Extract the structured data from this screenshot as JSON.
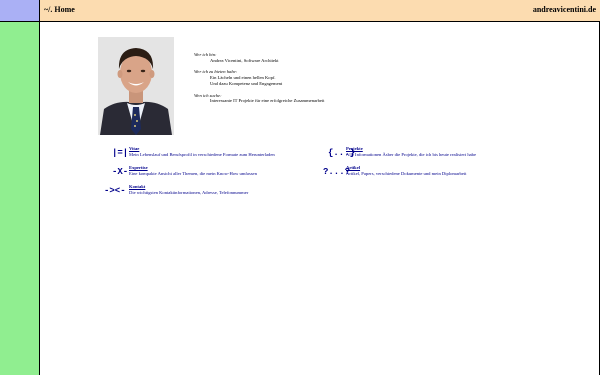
{
  "header": {
    "title": "~/. Home",
    "domain": "andreavicentini.de"
  },
  "intro": [
    {
      "question": "Wer ich bin:",
      "answers": [
        "Andrea Vicentini, Software Architekt"
      ]
    },
    {
      "question": "Wer ich zu bieten habe:",
      "answers": [
        "Ein Lächeln und einen hellen Kopf.",
        "Und dazu Kompetenz und Engagement"
      ]
    },
    {
      "question": "Wen ich suche:",
      "answers": [
        "Interessante IT Projekte für eine erfolgreiche Zusammenarbeit"
      ]
    }
  ],
  "links": {
    "vitae": {
      "symbol": "|=|",
      "name": "Vitae",
      "desc": "Mein Lebenslauf und Berufsprofil in verschiedene Formate zum Herunterladen"
    },
    "projekte": {
      "symbol": "{...}",
      "name": "Projekte",
      "desc": "Alle Informationen Äsber die Projekte, die ich bis heute realisiert habe"
    },
    "expertise": {
      "symbol": "-X-",
      "name": "Expertise",
      "desc": "Eine kompakte Ansicht aller Themen, die mein Know-How umfassen"
    },
    "artikel": {
      "symbol": "?...?",
      "name": "Artikel",
      "desc": "Artikel, Papers, verschiedene Dokumente und mein Diplomarbeit"
    },
    "kontakt": {
      "symbol": "-><-",
      "name": "Kontakt",
      "desc": "Die wichtigsten Kontaktinformationen, Adresse, Telefonnummer"
    }
  },
  "colors": {
    "header": "#fcdcb0",
    "sidebar": "#90ee90",
    "corner": "#aab0f5",
    "link": "#00008b"
  },
  "icons": {
    "photo": "portrait-photo"
  }
}
